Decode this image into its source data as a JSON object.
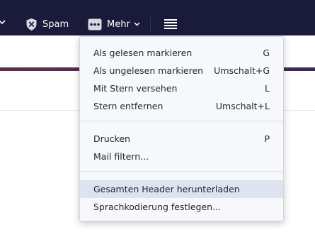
{
  "toolbar": {
    "spam_label": "Spam",
    "more_label": "Mehr"
  },
  "menu": {
    "items": [
      {
        "label": "Als gelesen markieren",
        "shortcut": "G"
      },
      {
        "label": "Als ungelesen markieren",
        "shortcut": "Umschalt+G"
      },
      {
        "label": "Mit Stern versehen",
        "shortcut": "L"
      },
      {
        "label": "Stern entfernen",
        "shortcut": "Umschalt+L"
      },
      {
        "label": "Drucken",
        "shortcut": "P"
      },
      {
        "label": "Mail filtern...",
        "shortcut": ""
      },
      {
        "label": "Gesamten Header herunterladen",
        "shortcut": ""
      },
      {
        "label": "Sprachkodierung festlegen...",
        "shortcut": ""
      }
    ],
    "highlighted_item": "Gesamten Header herunterladen"
  },
  "icons": [
    "chevron-left-icon",
    "shield-x-icon",
    "more-dots-icon",
    "chevron-down-icon",
    "list-view-icon"
  ],
  "colors": {
    "toolbar_bg": "#1a1b3a",
    "menu_bg": "#f7f8fb",
    "highlight_bg": "#dde4ef",
    "accent_strip": "#5a2f48"
  }
}
